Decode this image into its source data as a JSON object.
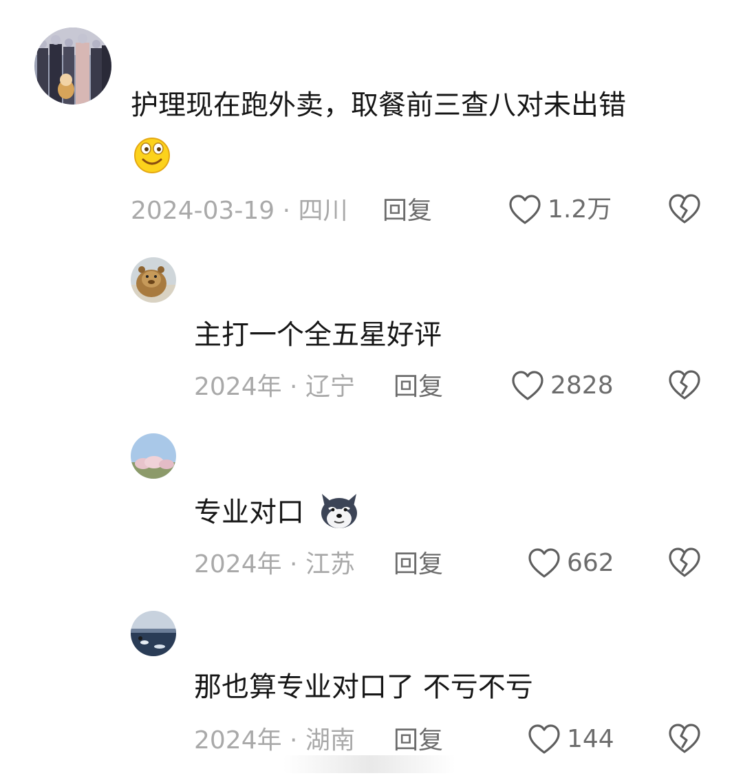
{
  "comments": [
    {
      "text": "护理现在跑外卖，取餐前三查八对未出错",
      "emoji": "smile-emoji",
      "date": "2024-03-19 · 四川",
      "reply_label": "回复",
      "like_count": "1.2万"
    },
    {
      "text": "主打一个全五星好评",
      "date": "2024年 · 辽宁",
      "reply_label": "回复",
      "like_count": "2828"
    },
    {
      "text": "专业对口",
      "emoji": "husky-dog-emoji",
      "date": "2024年 · 江苏",
      "reply_label": "回复",
      "like_count": "662"
    },
    {
      "text": "那也算专业对口了 不亏不亏",
      "date": "2024年 · 湖南",
      "reply_label": "回复",
      "like_count": "144"
    }
  ],
  "icons": {
    "like": "heart-outline-icon",
    "dislike": "broken-heart-icon"
  },
  "colors": {
    "meta_text": "#a9a9a9",
    "action_text": "#6c6c6c",
    "body_text": "#161616"
  }
}
